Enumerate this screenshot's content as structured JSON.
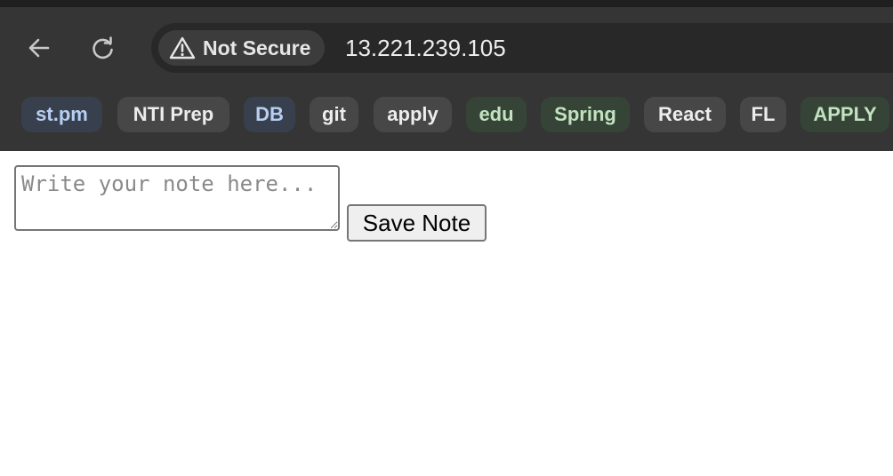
{
  "browser": {
    "security_label": "Not Secure",
    "url": "13.221.239.105",
    "icons": {
      "back": "arrow-left-icon",
      "reload": "reload-icon",
      "security": "warning-triangle-icon"
    },
    "colors": {
      "chrome_background": "#353535",
      "omnibox_background": "#282828"
    },
    "bookmarks": [
      {
        "label": "st.pm",
        "color_group": "blue"
      },
      {
        "label": "NTI Prep",
        "color_group": "gray"
      },
      {
        "label": "DB",
        "color_group": "blue"
      },
      {
        "label": "git",
        "color_group": "gray"
      },
      {
        "label": "apply",
        "color_group": "gray"
      },
      {
        "label": "edu",
        "color_group": "green"
      },
      {
        "label": "Spring",
        "color_group": "green"
      },
      {
        "label": "React",
        "color_group": "gray"
      },
      {
        "label": "FL",
        "color_group": "gray"
      },
      {
        "label": "APPLY",
        "color_group": "green"
      }
    ]
  },
  "page": {
    "note_input": {
      "value": "",
      "placeholder": "Write your note here..."
    },
    "save_button_label": "Save Note"
  }
}
